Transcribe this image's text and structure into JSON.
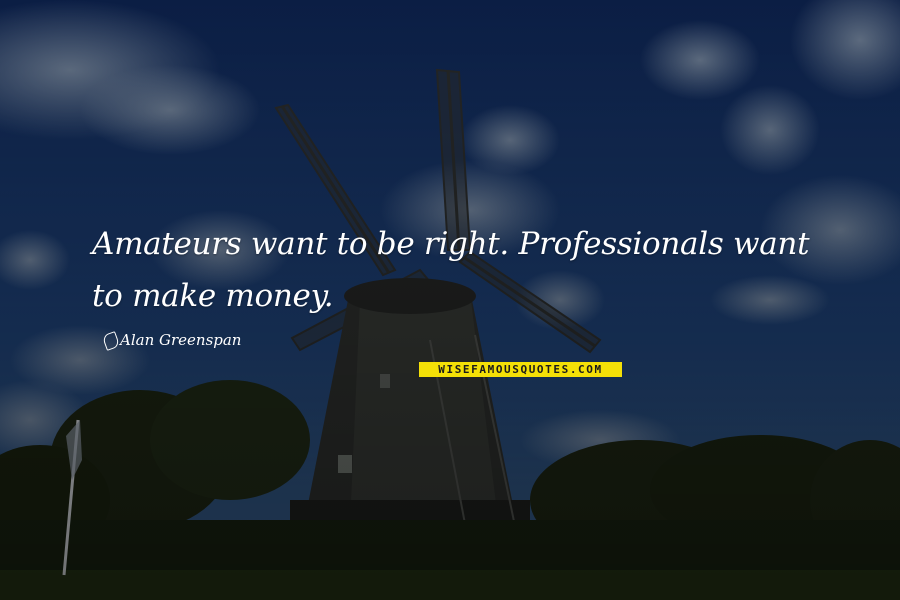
{
  "quote": {
    "text": "Amateurs want to be right. Professionals want to make money.",
    "author": "Alan Greenspan"
  },
  "watermark": {
    "text": "WISEFAMOUSQUOTES.COM",
    "background": "#f4e007"
  },
  "scene": {
    "subject": "windmill",
    "colors": {
      "sky_top": "#0e2452",
      "sky_bottom": "#244d83",
      "foliage": "#1f2a16",
      "text": "#ffffff"
    }
  }
}
